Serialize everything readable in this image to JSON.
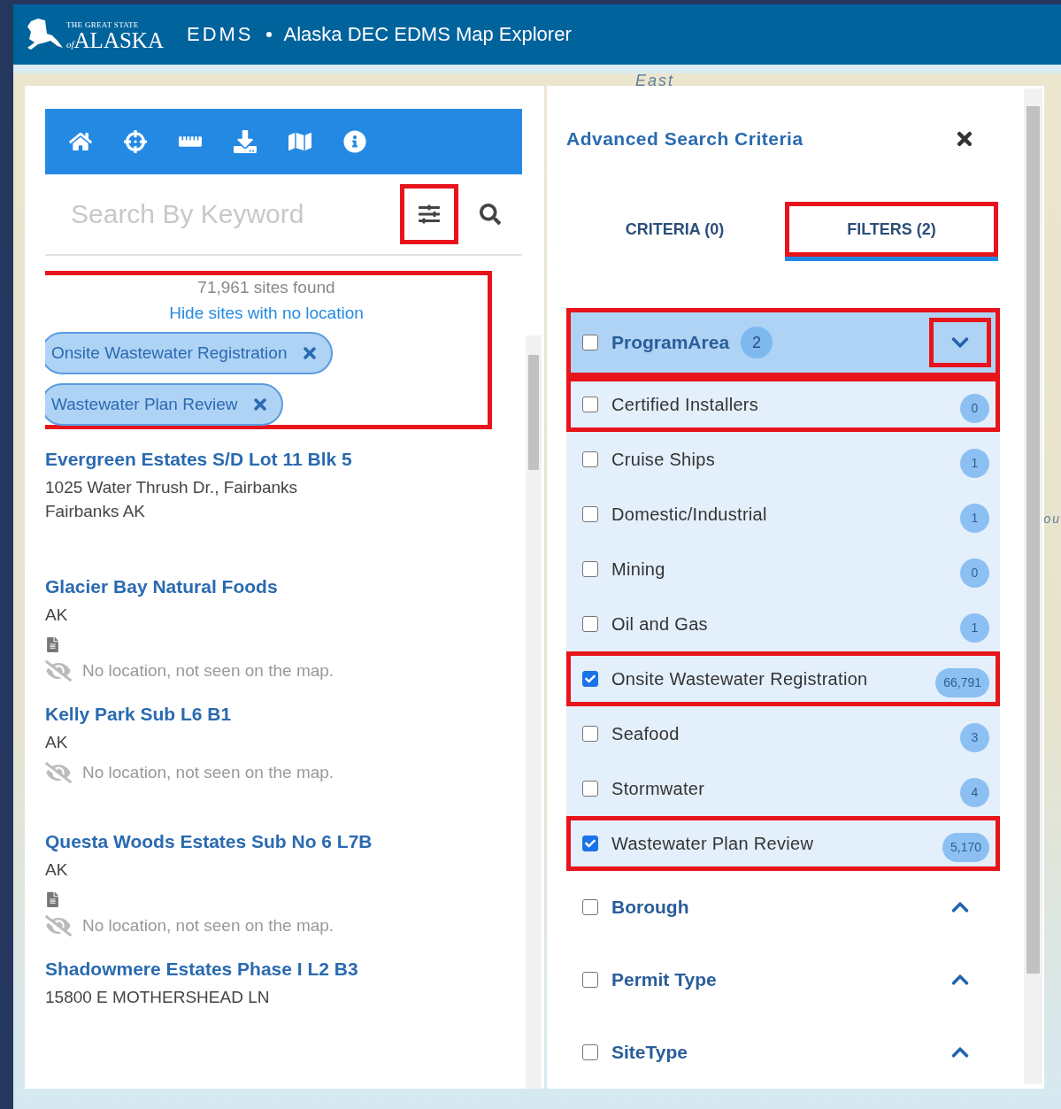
{
  "header": {
    "logo_top": "THE GREAT STATE",
    "logo_of": "of",
    "logo_main": "ALASKA",
    "app": "EDMS",
    "title": "Alaska DEC EDMS Map Explorer"
  },
  "map_labels": [
    "East",
    "ou"
  ],
  "left_panel": {
    "search": {
      "placeholder": "Search By Keyword",
      "filter_highlighted": true
    },
    "summary": {
      "count": "71,961 sites found",
      "link": "Hide sites with no location",
      "highlighted": true,
      "chips": [
        "Onsite Wastewater Registration",
        "Wastewater Plan Review"
      ]
    },
    "results": [
      {
        "name": "Evergreen Estates S/D Lot 11 Blk 5",
        "lines": [
          "1025 Water Thrush Dr., Fairbanks",
          "Fairbanks AK"
        ],
        "has_document": false
      },
      {
        "name": "Glacier Bay Natural Foods",
        "lines": [
          "AK"
        ],
        "has_document": true,
        "no_location": "No location, not seen on the map."
      },
      {
        "name": "Kelly Park Sub L6 B1",
        "lines": [
          "AK"
        ],
        "has_document": false,
        "no_location": "No location, not seen on the map."
      },
      {
        "name": "Questa Woods Estates Sub No 6 L7B",
        "lines": [
          "AK"
        ],
        "has_document": true,
        "no_location": "No location, not seen on the map."
      },
      {
        "name": "Shadowmere Estates Phase I L2 B3",
        "lines": [
          "15800 E MOTHERSHEAD LN"
        ],
        "has_document": false
      }
    ]
  },
  "right_panel": {
    "title": "Advanced Search Criteria",
    "tabs": [
      {
        "label": "CRITERIA (0)",
        "selected": false,
        "highlighted": false
      },
      {
        "label": "FILTERS (2)",
        "selected": true,
        "highlighted": true
      }
    ],
    "groups": [
      {
        "label": "ProgramArea",
        "badge": "2",
        "checked": false,
        "expanded": true,
        "highlighted": true,
        "toggle_highlighted": true,
        "items": [
          {
            "label": "Certified Installers",
            "count": "0",
            "checked": false,
            "highlighted": true
          },
          {
            "label": "Cruise Ships",
            "count": "1",
            "checked": false,
            "highlighted": false
          },
          {
            "label": "Domestic/Industrial",
            "count": "1",
            "checked": false,
            "highlighted": false
          },
          {
            "label": "Mining",
            "count": "0",
            "checked": false,
            "highlighted": false
          },
          {
            "label": "Oil and Gas",
            "count": "1",
            "checked": false,
            "highlighted": false
          },
          {
            "label": "Onsite Wastewater Registration",
            "count": "66,791",
            "checked": true,
            "highlighted": true
          },
          {
            "label": "Seafood",
            "count": "3",
            "checked": false,
            "highlighted": false
          },
          {
            "label": "Stormwater",
            "count": "4",
            "checked": false,
            "highlighted": false
          },
          {
            "label": "Wastewater Plan Review",
            "count": "5,170",
            "checked": true,
            "highlighted": true
          }
        ]
      },
      {
        "label": "Borough",
        "checked": false,
        "expanded": false,
        "highlighted": false,
        "toggle_highlighted": false
      },
      {
        "label": "Permit Type",
        "checked": false,
        "expanded": false,
        "highlighted": false,
        "toggle_highlighted": false
      },
      {
        "label": "SiteType",
        "checked": false,
        "expanded": false,
        "highlighted": false,
        "toggle_highlighted": false
      }
    ]
  }
}
